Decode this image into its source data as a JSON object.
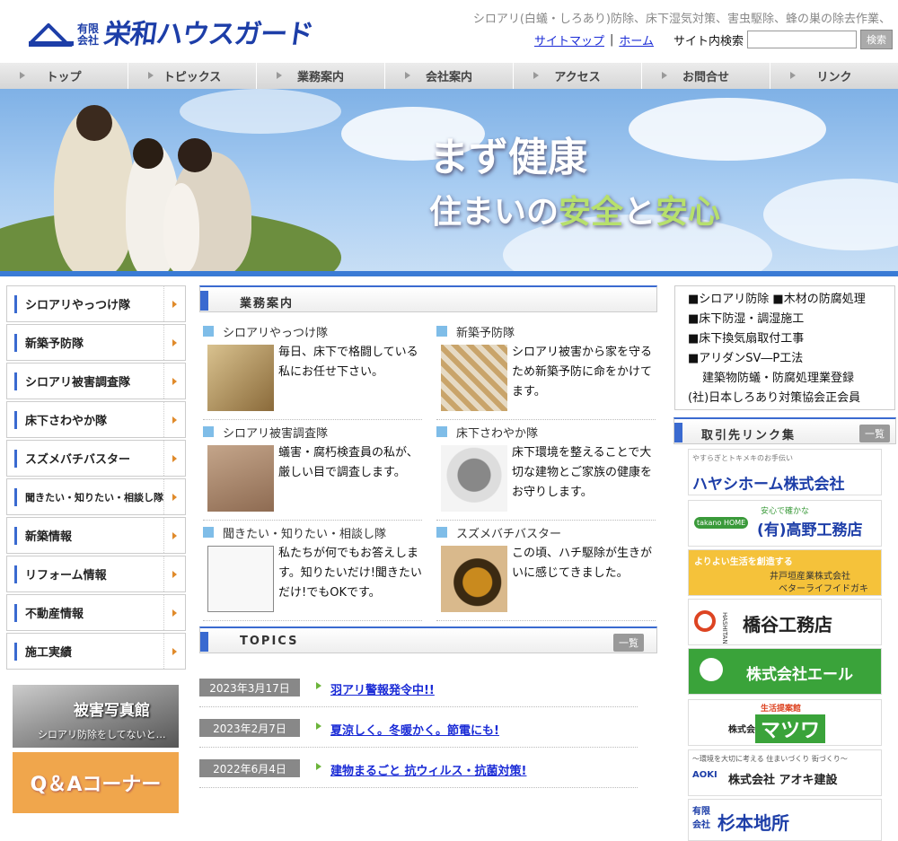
{
  "header": {
    "logo_small_1": "有限",
    "logo_small_2": "会社",
    "logo_main": "栄和ハウスガード",
    "tagline": "シロアリ(白蟻・しろあり)防除、床下湿気対策、害虫駆除、蜂の巣の除去作業、",
    "sitemap_link": "サイトマップ",
    "separator": "|",
    "home_link": "ホーム",
    "search_label": "サイト内検索",
    "search_value": "",
    "search_button": "検索"
  },
  "nav": [
    "トップ",
    "トピックス",
    "業務案内",
    "会社案内",
    "アクセス",
    "お問合せ",
    "リンク"
  ],
  "hero": {
    "title": "まず健康",
    "sub_1": "住まいの",
    "sub_2": "安全",
    "sub_3": "と",
    "sub_4": "安心"
  },
  "sidebar": [
    {
      "label": "シロアリやっつけ隊"
    },
    {
      "label": "新築予防隊"
    },
    {
      "label": "シロアリ被害調査隊"
    },
    {
      "label": "床下さわやか隊"
    },
    {
      "label": "スズメバチバスター"
    },
    {
      "label": "聞きたい・知りたい・相談し隊"
    },
    {
      "label": "新築情報"
    },
    {
      "label": "リフォーム情報"
    },
    {
      "label": "不動産情報"
    },
    {
      "label": "施工実績"
    }
  ],
  "banners": {
    "photo_title": "被害写真館",
    "photo_sub": "シロアリ防除をしてないと…",
    "qa": "Q＆Aコーナー"
  },
  "business": {
    "heading": "業務案内",
    "items": [
      {
        "title": "シロアリやっつけ隊",
        "desc": "毎日、床下で格闘している私にお任せ下さい。"
      },
      {
        "title": "新築予防隊",
        "desc": "シロアリ被害から家を守るため新築予防に命をかけてます。"
      },
      {
        "title": "シロアリ被害調査隊",
        "desc": "蟻害・腐朽検査員の私が、厳しい目で調査します。"
      },
      {
        "title": "床下さわやか隊",
        "desc": "床下環境を整えることで大切な建物とご家族の健康をお守りします。"
      },
      {
        "title": "聞きたい・知りたい・相談し隊",
        "desc": "私たちが何でもお答えします。知りたいだけ!聞きたいだけ!でもOKです。"
      },
      {
        "title": "スズメバチバスター",
        "desc": "この頃、ハチ駆除が生きがいに感じてきました。"
      }
    ]
  },
  "topics": {
    "heading": "TOPICS",
    "more": "一覧",
    "items": [
      {
        "date": "2023年3月17日",
        "title": "羽アリ警報発令中!!"
      },
      {
        "date": "2023年2月7日",
        "title": "夏涼しく。冬暖かく。節電にも!"
      },
      {
        "date": "2022年6月4日",
        "title": "建物まるごと 抗ウィルス・抗菌対策!"
      }
    ]
  },
  "info": {
    "line1": "■シロアリ防除 ■木材の防腐処理",
    "line2": "■床下防湿・調湿施工",
    "line3": "■床下換気扇取付工事",
    "line4": "■アリダンSV―P工法",
    "line5": "建築物防蟻・防腐処理業登録",
    "line6": "(社)日本しろあり対策協会正会員"
  },
  "links": {
    "heading": "取引先リンク集",
    "more": "一覧",
    "items": [
      {
        "name": "ハヤシホーム株式会社",
        "sub": "やすらぎとトキメキのお手伝い"
      },
      {
        "name": "(有)高野工務店",
        "sub": "安心で確かな",
        "badge": "takano HOME"
      },
      {
        "name": "井戸垣産業株式会社",
        "sub": "よりよい生活を創造する",
        "sub2": "ベターライフイドガキ"
      },
      {
        "name": "橋谷工務店",
        "sub": "HASHITANI"
      },
      {
        "name": "株式会社エール"
      },
      {
        "name": "マツワ",
        "sub": "生活提案館",
        "sub2": "株式会社"
      },
      {
        "name": "株式会社 アオキ建設",
        "sub": "～環境を大切に考える 住まいづくり 街づくり～",
        "badge": "AOKI"
      },
      {
        "name": "杉本地所",
        "sub": "有限会社"
      }
    ]
  },
  "colors": {
    "accent": "#3a6ad0",
    "link": "#1a2bd6",
    "arrow": "#e08a2a",
    "topic_arrow": "#6bb43a"
  }
}
